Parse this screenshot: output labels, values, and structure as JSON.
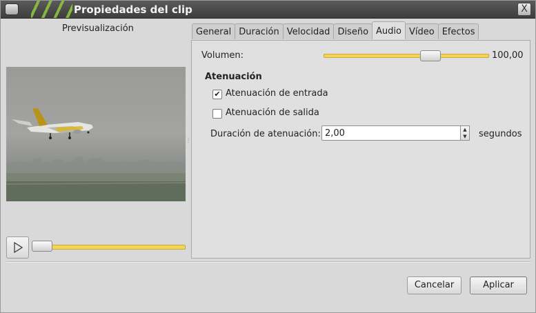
{
  "window": {
    "title": "Propiedades del clip",
    "close_label": "X"
  },
  "preview": {
    "label": "Previsualización",
    "position": 0
  },
  "tabs": [
    {
      "label": "General",
      "active": false
    },
    {
      "label": "Duración",
      "active": false
    },
    {
      "label": "Velocidad",
      "active": false
    },
    {
      "label": "Diseño",
      "active": false
    },
    {
      "label": "Audio",
      "active": true
    },
    {
      "label": "Vídeo",
      "active": false
    },
    {
      "label": "Efectos",
      "active": false
    }
  ],
  "audio": {
    "volume_label": "Volumen:",
    "volume_value": "100,00",
    "volume_fraction": 0.6,
    "fade_heading": "Atenuación",
    "fade_in_label": "Atenuación de entrada",
    "fade_in_checked": true,
    "fade_out_label": "Atenuación de salida",
    "fade_out_checked": false,
    "fade_duration_label": "Duración de atenuación:",
    "fade_duration_value": "2,00",
    "fade_duration_unit": "segundos"
  },
  "buttons": {
    "cancel": "Cancelar",
    "apply": "Aplicar"
  },
  "colors": {
    "slider_track": "#f2d45a",
    "titlebar": "#4a4a4a",
    "accent_stripes": "#8cc43b"
  },
  "icons": {
    "play": "play-icon",
    "close": "close-icon",
    "check": "checkmark-icon"
  }
}
